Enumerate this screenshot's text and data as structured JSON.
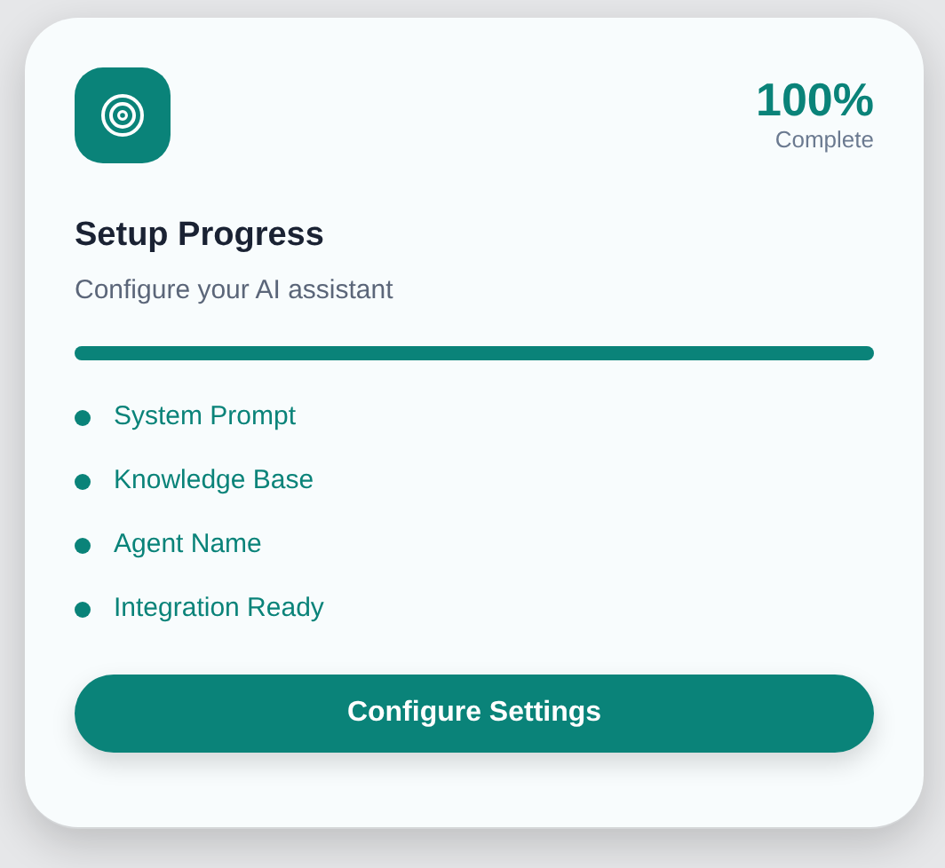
{
  "card": {
    "percent": "100%",
    "percent_caption": "Complete",
    "title": "Setup Progress",
    "subtitle": "Configure your AI assistant",
    "progress": {
      "level": 1
    },
    "steps": [
      {
        "label": "System Prompt"
      },
      {
        "label": "Knowledge Base"
      },
      {
        "label": "Agent Name"
      },
      {
        "label": "Integration Ready"
      }
    ],
    "button": "Configure Settings"
  }
}
